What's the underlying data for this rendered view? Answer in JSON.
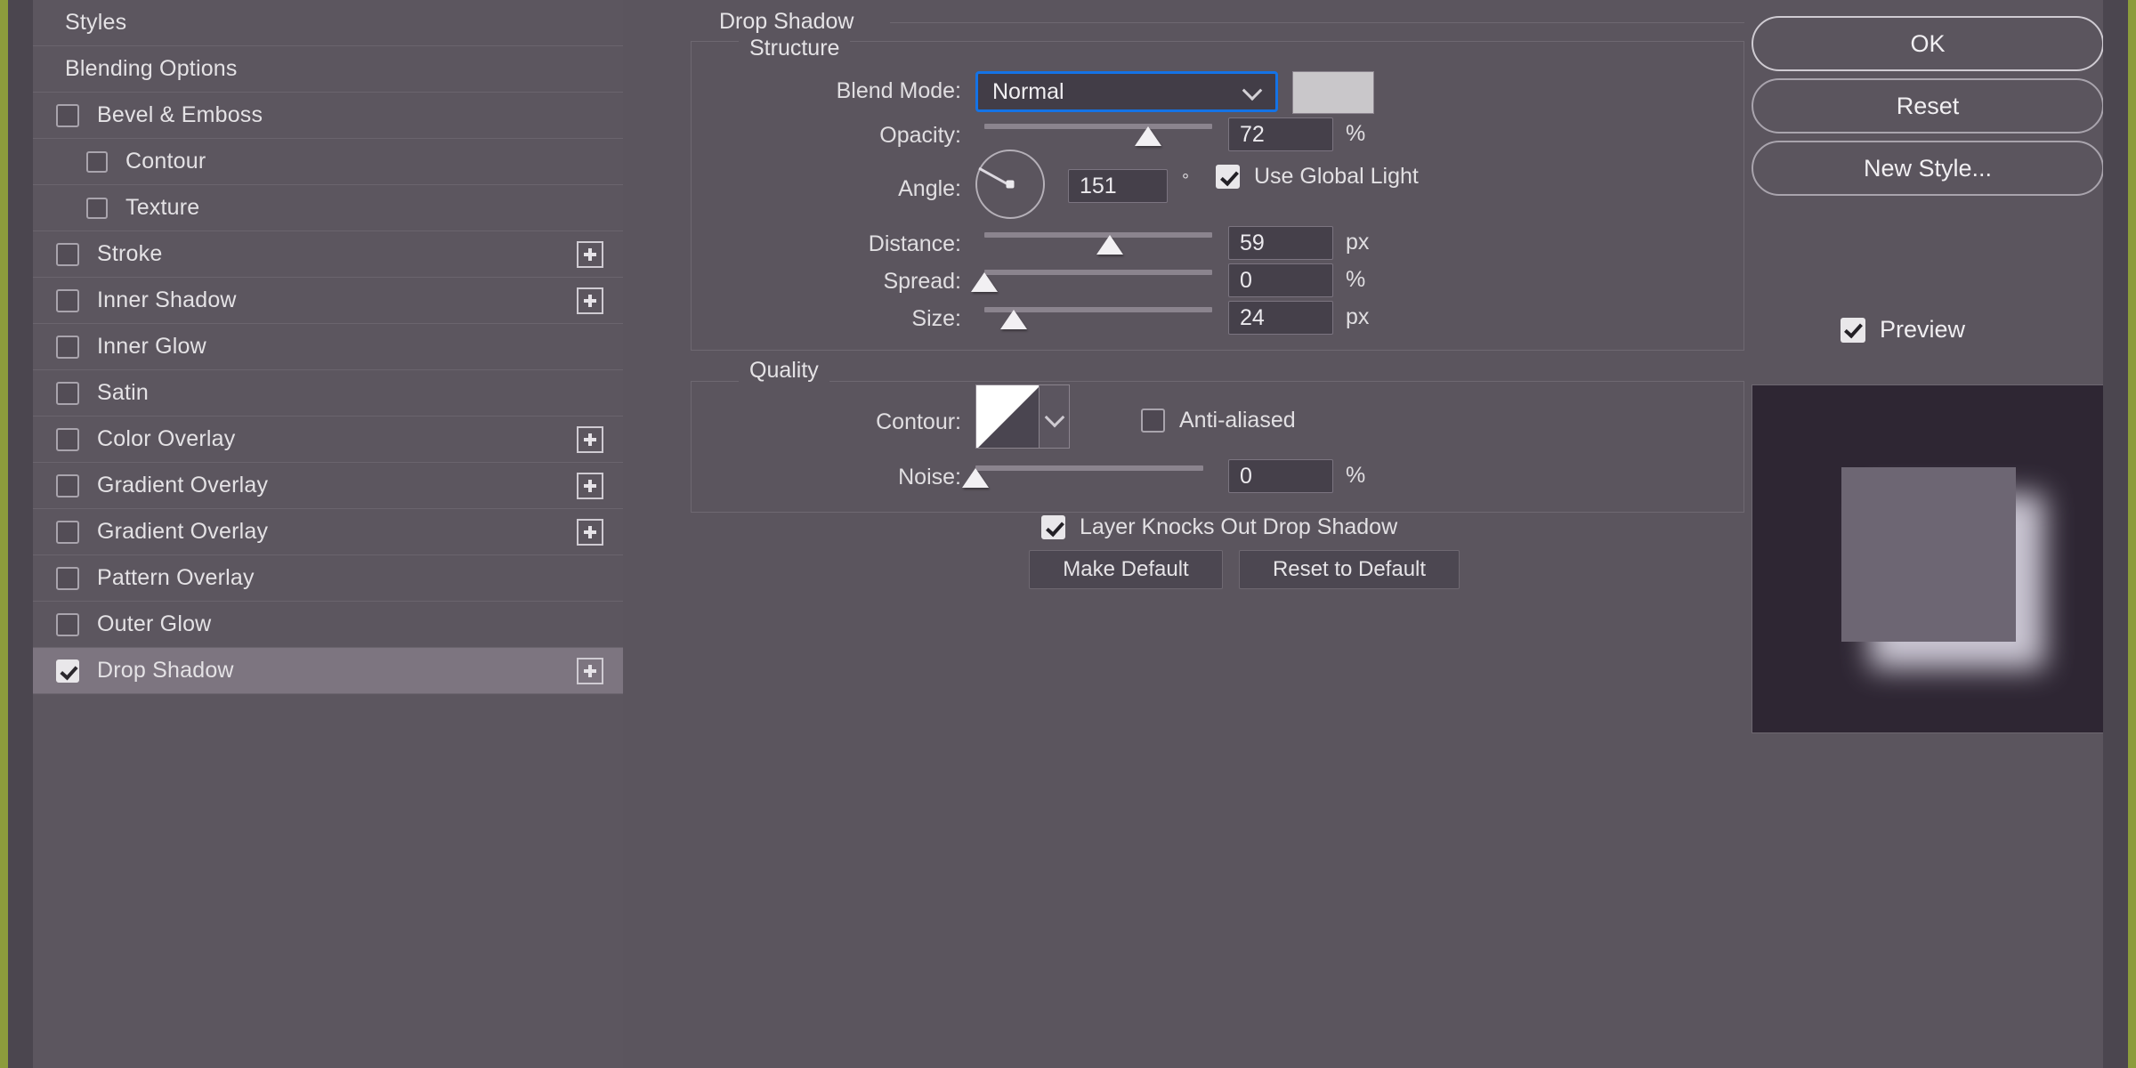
{
  "theme": {
    "accent_edge": "#8c9c3c",
    "panel_bg": "#5b555e",
    "focus_ring": "#1473e6",
    "selected_row": "#7d7580"
  },
  "sidebar": {
    "items": [
      {
        "label": "Styles",
        "type": "header",
        "checkbox": false,
        "checked": false,
        "plus": false,
        "indent": 0,
        "selected": false
      },
      {
        "label": "Blending Options",
        "type": "header",
        "checkbox": false,
        "checked": false,
        "plus": false,
        "indent": 0,
        "selected": false
      },
      {
        "label": "Bevel & Emboss",
        "type": "effect",
        "checkbox": true,
        "checked": false,
        "plus": false,
        "indent": 0,
        "selected": false
      },
      {
        "label": "Contour",
        "type": "sub",
        "checkbox": true,
        "checked": false,
        "plus": false,
        "indent": 1,
        "selected": false
      },
      {
        "label": "Texture",
        "type": "sub",
        "checkbox": true,
        "checked": false,
        "plus": false,
        "indent": 1,
        "selected": false
      },
      {
        "label": "Stroke",
        "type": "effect",
        "checkbox": true,
        "checked": false,
        "plus": true,
        "indent": 0,
        "selected": false
      },
      {
        "label": "Inner Shadow",
        "type": "effect",
        "checkbox": true,
        "checked": false,
        "plus": true,
        "indent": 0,
        "selected": false
      },
      {
        "label": "Inner Glow",
        "type": "effect",
        "checkbox": true,
        "checked": false,
        "plus": false,
        "indent": 0,
        "selected": false
      },
      {
        "label": "Satin",
        "type": "effect",
        "checkbox": true,
        "checked": false,
        "plus": false,
        "indent": 0,
        "selected": false
      },
      {
        "label": "Color Overlay",
        "type": "effect",
        "checkbox": true,
        "checked": false,
        "plus": true,
        "indent": 0,
        "selected": false
      },
      {
        "label": "Gradient Overlay",
        "type": "effect",
        "checkbox": true,
        "checked": false,
        "plus": true,
        "indent": 0,
        "selected": false
      },
      {
        "label": "Gradient Overlay",
        "type": "effect",
        "checkbox": true,
        "checked": false,
        "plus": true,
        "indent": 0,
        "selected": false
      },
      {
        "label": "Pattern Overlay",
        "type": "effect",
        "checkbox": true,
        "checked": false,
        "plus": false,
        "indent": 0,
        "selected": false
      },
      {
        "label": "Outer Glow",
        "type": "effect",
        "checkbox": true,
        "checked": false,
        "plus": false,
        "indent": 0,
        "selected": false
      },
      {
        "label": "Drop Shadow",
        "type": "effect",
        "checkbox": true,
        "checked": true,
        "plus": true,
        "indent": 0,
        "selected": true
      }
    ]
  },
  "main": {
    "effect_title": "Drop Shadow",
    "structure": {
      "legend": "Structure",
      "blend_mode": {
        "label": "Blend Mode:",
        "value": "Normal",
        "swatch_color": "#c9c7ca",
        "chevron": "chevron-down-icon"
      },
      "opacity": {
        "label": "Opacity:",
        "value": "72",
        "unit": "%",
        "slider_pct": 72
      },
      "angle": {
        "label": "Angle:",
        "value": "151",
        "unit": "°"
      },
      "use_global_light": {
        "label": "Use Global Light",
        "checked": true
      },
      "distance": {
        "label": "Distance:",
        "value": "59",
        "unit": "px",
        "slider_pct": 55
      },
      "spread": {
        "label": "Spread:",
        "value": "0",
        "unit": "%",
        "slider_pct": 0
      },
      "size": {
        "label": "Size:",
        "value": "24",
        "unit": "px",
        "slider_pct": 13
      }
    },
    "quality": {
      "legend": "Quality",
      "contour": {
        "label": "Contour:",
        "preview": "linear-contour-swatch"
      },
      "anti_aliased": {
        "label": "Anti-aliased",
        "checked": false
      },
      "noise": {
        "label": "Noise:",
        "value": "0",
        "unit": "%",
        "slider_pct": 0
      }
    },
    "layer_knocks_out": {
      "label": "Layer Knocks Out Drop Shadow",
      "checked": true
    },
    "make_default_label": "Make Default",
    "reset_to_default_label": "Reset to Default"
  },
  "right": {
    "ok_label": "OK",
    "reset_label": "Reset",
    "new_style_label": "New Style...",
    "preview_label": "Preview",
    "preview_checked": true
  }
}
